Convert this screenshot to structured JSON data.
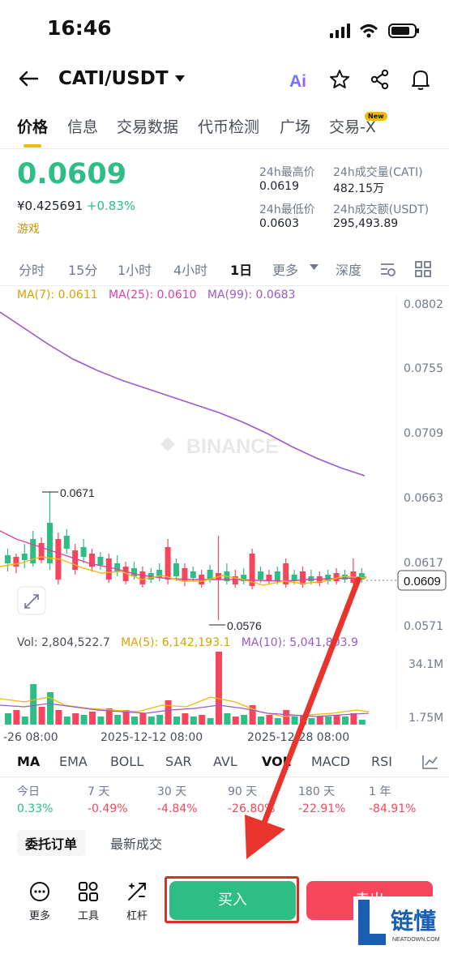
{
  "status_bar": {
    "time": "16:46"
  },
  "header": {
    "pair": "CATI/USDT"
  },
  "tabs": [
    "价格",
    "信息",
    "交易数据",
    "代币检测",
    "广场",
    "交易-X"
  ],
  "new_badge": "New",
  "ticker": {
    "price": "0.0609",
    "cny": "¥0.425691",
    "change": "+0.83%",
    "tag": "游戏",
    "high_label": "24h最高价",
    "high": "0.0619",
    "low_label": "24h最低价",
    "low": "0.0603",
    "vol_label": "24h成交量(CATI)",
    "vol": "482.15万",
    "amt_label": "24h成交额(USDT)",
    "amt": "295,493.89"
  },
  "intervals": [
    "分时",
    "15分",
    "1小时",
    "4小时",
    "1日",
    "更多",
    "深度"
  ],
  "ma": {
    "ma7": "MA(7): 0.0611",
    "ma25": "MA(25): 0.0610",
    "ma99": "MA(99): 0.0683"
  },
  "price_axis": [
    "0.0802",
    "0.0755",
    "0.0709",
    "0.0663",
    "0.0617",
    "0.0571"
  ],
  "current_price_tag": "0.0609",
  "high_marker": "0.0671",
  "low_marker": "0.0576",
  "watermark": "BINANCE",
  "vol_line": {
    "vol": "Vol: 2,804,522.7",
    "ma5": "MA(5): 6,142,193.1",
    "ma10": "MA(10): 5,041,803.9"
  },
  "vol_axis": [
    "34.1M",
    "1.75M"
  ],
  "dates": [
    "-26 08:00",
    "2025-12-12 08:00",
    "2025-12-28 08:00"
  ],
  "indicators": [
    "MA",
    "EMA",
    "BOLL",
    "SAR",
    "AVL",
    "VOL",
    "MACD",
    "RSI"
  ],
  "performance": [
    {
      "label": "今日",
      "value": "0.33%"
    },
    {
      "label": "7 天",
      "value": "-0.49%"
    },
    {
      "label": "30 天",
      "value": "-4.84%"
    },
    {
      "label": "90 天",
      "value": "-26.80%"
    },
    {
      "label": "180 天",
      "value": "-22.91%"
    },
    {
      "label": "1 年",
      "value": "-84.91%"
    }
  ],
  "bottom_tabs": [
    "委托订单",
    "最新成交"
  ],
  "tools": [
    "更多",
    "工具",
    "杠杆"
  ],
  "buy_label": "买入",
  "sell_label": "卖出",
  "watermark_logo": {
    "text": "链懂",
    "sub": "NEATDOWN.COM"
  },
  "colors": {
    "up": "#2ebd85",
    "down": "#f6465d",
    "accent": "#f0b90b",
    "ma7": "#f0b90b",
    "ma25": "#e040a0",
    "ma99": "#9b59d0"
  }
}
